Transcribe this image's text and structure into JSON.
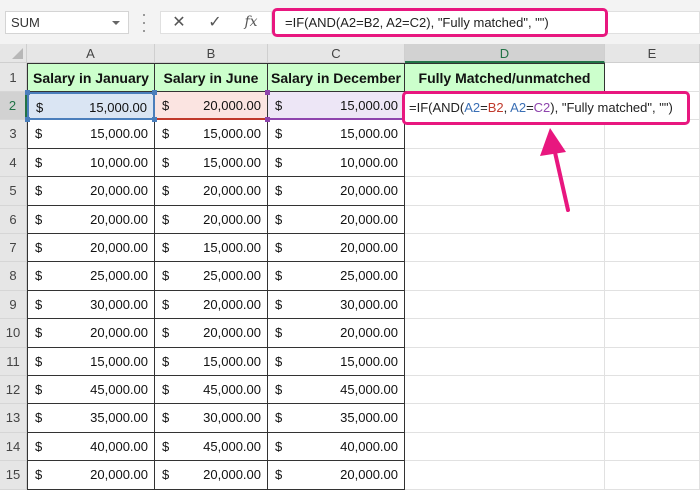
{
  "name_box": {
    "value": "SUM"
  },
  "formula_bar": {
    "cancel_icon": "✕",
    "enter_icon": "✓",
    "fx_label": "fx",
    "formula": "=IF(AND(A2=B2, A2=C2), \"Fully matched\", \"\")"
  },
  "columns": [
    "A",
    "B",
    "C",
    "D",
    "E"
  ],
  "selected_column": "D",
  "rows": [
    "1",
    "2",
    "3",
    "4",
    "5",
    "6",
    "7",
    "8",
    "9",
    "10",
    "11",
    "12",
    "13",
    "14",
    "15"
  ],
  "selected_row": "2",
  "headers": {
    "A": "Salary in January",
    "B": "Salary in June",
    "C": "Salary in December",
    "D": "Fully Matched/unmatched"
  },
  "currency_symbol": "$",
  "data": [
    {
      "row": "2",
      "A": "15,000.00",
      "B": "20,000.00",
      "C": "15,000.00"
    },
    {
      "row": "3",
      "A": "15,000.00",
      "B": "15,000.00",
      "C": "15,000.00"
    },
    {
      "row": "4",
      "A": "10,000.00",
      "B": "15,000.00",
      "C": "10,000.00"
    },
    {
      "row": "5",
      "A": "20,000.00",
      "B": "20,000.00",
      "C": "20,000.00"
    },
    {
      "row": "6",
      "A": "20,000.00",
      "B": "20,000.00",
      "C": "20,000.00"
    },
    {
      "row": "7",
      "A": "20,000.00",
      "B": "15,000.00",
      "C": "20,000.00"
    },
    {
      "row": "8",
      "A": "25,000.00",
      "B": "25,000.00",
      "C": "25,000.00"
    },
    {
      "row": "9",
      "A": "30,000.00",
      "B": "20,000.00",
      "C": "30,000.00"
    },
    {
      "row": "10",
      "A": "20,000.00",
      "B": "20,000.00",
      "C": "20,000.00"
    },
    {
      "row": "11",
      "A": "15,000.00",
      "B": "15,000.00",
      "C": "15,000.00"
    },
    {
      "row": "12",
      "A": "45,000.00",
      "B": "45,000.00",
      "C": "45,000.00"
    },
    {
      "row": "13",
      "A": "35,000.00",
      "B": "30,000.00",
      "C": "35,000.00"
    },
    {
      "row": "14",
      "A": "40,000.00",
      "B": "45,000.00",
      "C": "40,000.00"
    },
    {
      "row": "15",
      "A": "20,000.00",
      "B": "20,000.00",
      "C": "20,000.00"
    }
  ],
  "edit_cell": {
    "address": "D2",
    "parts": [
      {
        "text": "=IF(AND(",
        "ref": ""
      },
      {
        "text": "A2",
        "ref": "a"
      },
      {
        "text": "=",
        "ref": ""
      },
      {
        "text": "B2",
        "ref": "b"
      },
      {
        "text": ", ",
        "ref": ""
      },
      {
        "text": "A2",
        "ref": "a"
      },
      {
        "text": "=",
        "ref": ""
      },
      {
        "text": "C2",
        "ref": "c"
      },
      {
        "text": "), \"Fully matched\", \"\")",
        "ref": ""
      }
    ]
  },
  "colors": {
    "highlight": "#e8177f",
    "header_fill": "#ccffcc",
    "ref_a": "#3a6fb5",
    "ref_b": "#c0392b",
    "ref_c": "#8e44ad",
    "excel_green": "#217346"
  }
}
